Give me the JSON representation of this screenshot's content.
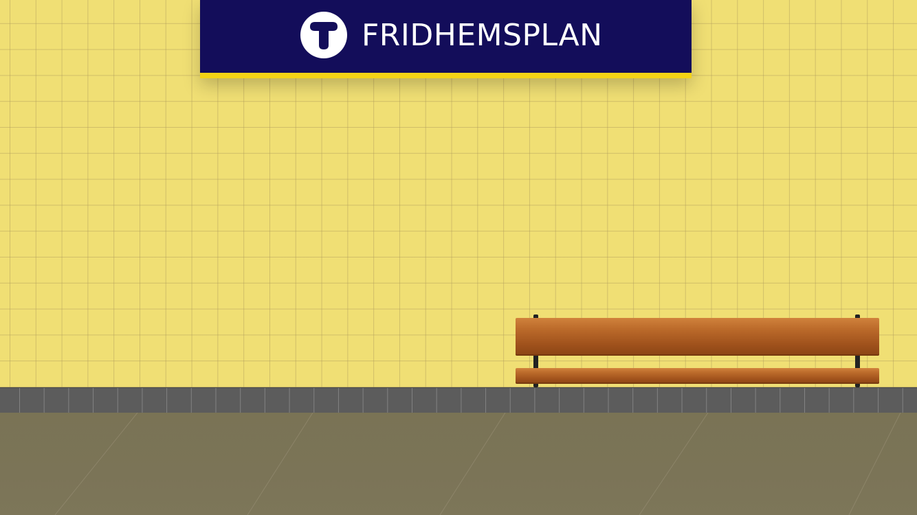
{
  "station_sign": {
    "name": "FRIDHEMSPLAN",
    "logo_icon": "tunnelbana-t-icon",
    "colors": {
      "background": "#130d5a",
      "stripe": "#f4d315",
      "text": "#ffffff"
    }
  },
  "scene": {
    "wall_color": "#f0df74",
    "baseboard_color": "#5c5c5c",
    "floor_color": "#7a7355",
    "bench_wood_color": "#b0612a"
  }
}
